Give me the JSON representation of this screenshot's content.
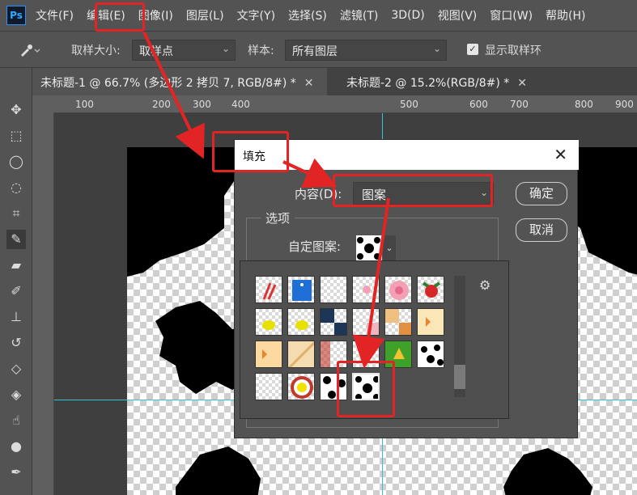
{
  "app": {
    "logo": "Ps"
  },
  "menu": [
    "文件(F)",
    "编辑(E)",
    "图像(I)",
    "图层(L)",
    "文字(Y)",
    "选择(S)",
    "滤镜(T)",
    "3D(D)",
    "视图(V)",
    "窗口(W)",
    "帮助(H)"
  ],
  "options": {
    "tool_icon": "eyedropper-icon",
    "sample_size_label": "取样大小:",
    "sample_size_value": "取样点",
    "sample_label": "样本:",
    "sample_value": "所有图层",
    "show_ring_label": "显示取样环",
    "show_ring_checked": true
  },
  "tabs": [
    {
      "title": "未标题-1 @ 66.7% (多边形 2 拷贝 7, RGB/8#) *",
      "active": true
    },
    {
      "title": "未标题-2 @ 15.2%(RGB/8#) *",
      "active": false
    }
  ],
  "ruler": {
    "ticks": [
      "100",
      "100",
      "200",
      "300",
      "400",
      "500",
      "600",
      "700",
      "800",
      "900"
    ]
  },
  "tools": [
    "move-icon",
    "marquee-icon",
    "lasso-icon",
    "quick-select-icon",
    "crop-icon",
    "eyedropper-icon",
    "healing-brush-icon",
    "brush-icon",
    "stamp-icon",
    "history-brush-icon",
    "eraser-icon",
    "paint-bucket-icon",
    "smudge-icon",
    "dodge-icon",
    "pen-icon"
  ],
  "dialog": {
    "title": "填充",
    "content_label": "内容(D):",
    "content_value": "图案",
    "ok_label": "确定",
    "cancel_label": "取消",
    "options_label": "选项",
    "custom_pattern_label": "自定图案:"
  },
  "colors": {
    "annotation": "#e32424",
    "guide": "#34c3d1"
  },
  "patterns": [
    {
      "name": "candy-cane-pattern"
    },
    {
      "name": "blue-tag-pattern"
    },
    {
      "name": "plain-pattern"
    },
    {
      "name": "pink-dots-pattern"
    },
    {
      "name": "pink-flower-pattern"
    },
    {
      "name": "strawberry-pattern"
    },
    {
      "name": "lemon-pattern"
    },
    {
      "name": "lemon-pattern-2"
    },
    {
      "name": "navy-check-pattern"
    },
    {
      "name": "pink-check-pattern"
    },
    {
      "name": "orange-check-pattern"
    },
    {
      "name": "autumn-leaf-pattern"
    },
    {
      "name": "maple-pattern"
    },
    {
      "name": "stripe-pattern"
    },
    {
      "name": "red-fade-pattern"
    },
    {
      "name": "leaf-pattern"
    },
    {
      "name": "green-bell-pattern"
    },
    {
      "name": "cow-print-pattern"
    },
    {
      "name": "plain-pattern-2"
    },
    {
      "name": "egg-pattern"
    },
    {
      "name": "cow-print-pattern-2"
    },
    {
      "name": "cow-print-selected-pattern"
    }
  ]
}
